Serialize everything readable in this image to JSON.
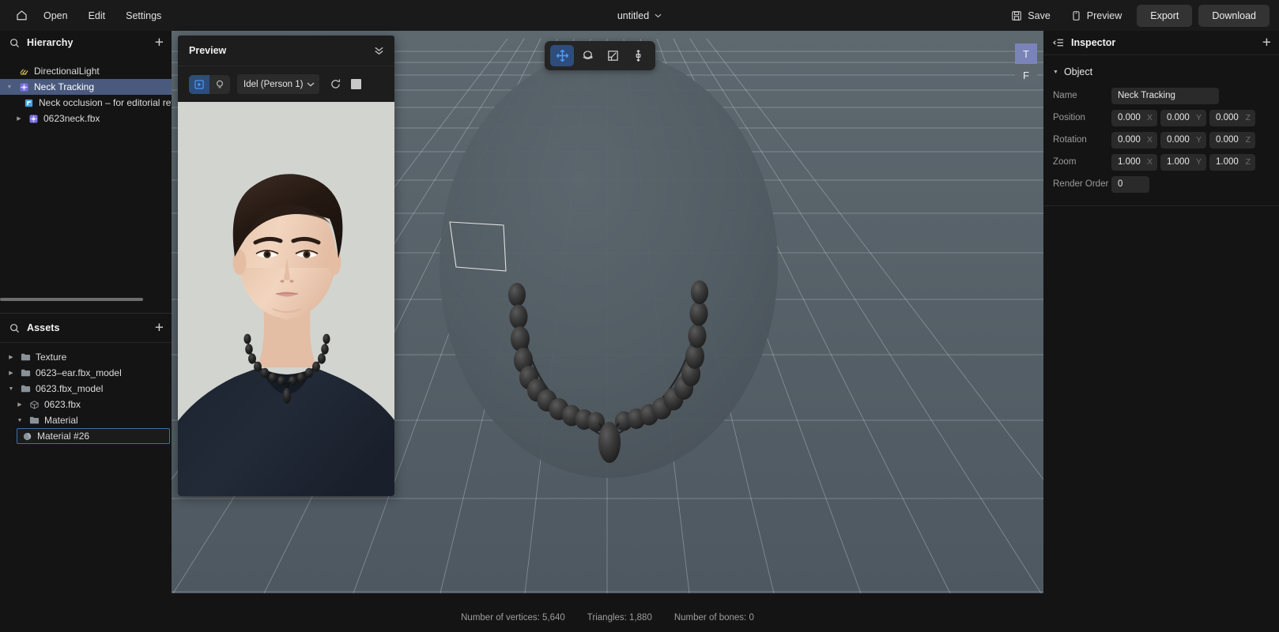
{
  "topbar": {
    "home_icon": "home-icon",
    "menus": [
      {
        "label": "Open"
      },
      {
        "label": "Edit"
      },
      {
        "label": "Settings"
      }
    ],
    "doc_title": "untitled",
    "doc_caret": "chevron-down-icon",
    "actions": [
      {
        "label": "Save",
        "icon": "save-floppy-icon"
      },
      {
        "label": "Preview",
        "icon": "mobile-phone-icon"
      }
    ],
    "buttons": [
      {
        "label": "Export"
      },
      {
        "label": "Download"
      }
    ]
  },
  "hierarchy": {
    "title": "Hierarchy",
    "search_icon": "search-icon",
    "add_icon": "plus-icon",
    "items": [
      {
        "label": "DirectionalLight",
        "icon": "directional-light-icon",
        "indent": 18,
        "twisty": "",
        "selected": false
      },
      {
        "label": "Neck Tracking",
        "icon": "node-3d-icon",
        "indent": 18,
        "twisty": "open",
        "selected": true
      },
      {
        "label": "Neck occlusion – for editorial refe",
        "icon": "mesh-plane-icon",
        "indent": 36,
        "twisty": "",
        "selected": false
      },
      {
        "label": "0623neck.fbx",
        "icon": "node-3d-icon",
        "indent": 22,
        "twisty": "closed",
        "selected": false
      }
    ]
  },
  "assets": {
    "title": "Assets",
    "search_icon": "search-icon",
    "add_icon": "plus-icon",
    "items": [
      {
        "label": "Texture",
        "icon": "folder-icon",
        "indent": 10,
        "twisty": "closed",
        "outlined": false
      },
      {
        "label": "0623–ear.fbx_model",
        "icon": "folder-icon",
        "indent": 10,
        "twisty": "closed",
        "outlined": false
      },
      {
        "label": "0623.fbx_model",
        "icon": "folder-icon",
        "indent": 10,
        "twisty": "open",
        "outlined": false
      },
      {
        "label": "0623.fbx",
        "icon": "cube-icon",
        "indent": 21,
        "twisty": "closed",
        "outlined": false
      },
      {
        "label": "Material",
        "icon": "folder-icon",
        "indent": 21,
        "twisty": "open",
        "outlined": false
      },
      {
        "label": "Material #26",
        "icon": "material-sphere-icon",
        "indent": 32,
        "twisty": "",
        "outlined": true
      }
    ]
  },
  "preview": {
    "title": "Preview",
    "collapse_icon": "chevron-double-down-icon",
    "mode_buttons": [
      {
        "icon": "play-frame-icon",
        "active": true
      },
      {
        "icon": "light-bulb-icon",
        "active": false
      }
    ],
    "animation_selected": "Idel (Person 1)",
    "select_caret": "chevron-down-icon",
    "refresh_icon": "refresh-icon",
    "stop_icon": "stop-square-icon"
  },
  "viewport": {
    "tools": [
      {
        "icon": "move-gizmo-icon",
        "active": true
      },
      {
        "icon": "rotate-gizmo-icon",
        "active": false
      },
      {
        "icon": "scale-gizmo-icon",
        "active": false
      },
      {
        "icon": "transform-gizmo-icon",
        "active": false
      }
    ],
    "axis_badges": [
      {
        "label": "T",
        "variant": "t"
      },
      {
        "label": "F",
        "variant": "f"
      }
    ]
  },
  "inspector": {
    "title": "Inspector",
    "list_icon": "properties-list-icon",
    "add_icon": "plus-icon",
    "section": {
      "label": "Object",
      "caret": "triangle-down-icon"
    },
    "properties": {
      "name_label": "Name",
      "name_value": "Neck Tracking",
      "position_label": "Position",
      "position": {
        "x": "0.000",
        "y": "0.000",
        "z": "0.000"
      },
      "rotation_label": "Rotation",
      "rotation": {
        "x": "0.000",
        "y": "0.000",
        "z": "0.000"
      },
      "zoom_label": "Zoom",
      "zoom": {
        "x": "1.000",
        "y": "1.000",
        "z": "1.000"
      },
      "render_order_label": "Render Order",
      "render_order": "0"
    },
    "axis_x": "X",
    "axis_y": "Y",
    "axis_z": "Z"
  },
  "statusbar": {
    "vertices": "Number of vertices: 5,640",
    "triangles": "Triangles: 1,880",
    "bones": "Number of bones: 0"
  },
  "colors": {
    "accent_blue": "#2f4d7a",
    "accent_icon": "#4a9eff",
    "selection_row": "#4a5a7e",
    "viewport_bg": "#58636a",
    "panel_bg": "#141414",
    "topbar_bg": "#1a1a1a",
    "badge_t": "#7b84b8",
    "badge_f": "#5e676d",
    "preview_stage_bg": "#d2d4cf"
  }
}
